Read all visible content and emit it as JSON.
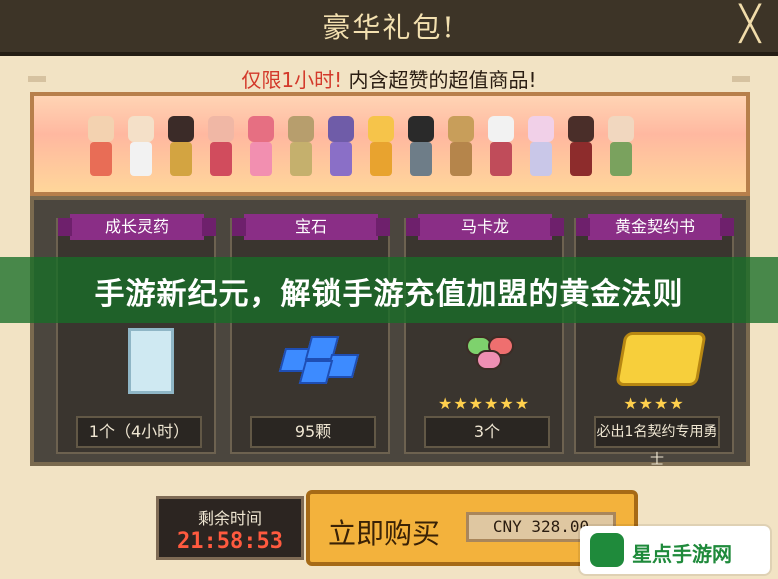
{
  "window": {
    "title": "豪华礼包!",
    "close_label": "╳"
  },
  "subtitle": {
    "red": "仅限1小时!",
    "black": "内含超赞的超值商品!"
  },
  "items": [
    {
      "tag": "成长灵药",
      "quantity": "1个（4小时）",
      "stars": ""
    },
    {
      "tag": "宝石",
      "quantity": "95颗",
      "stars": ""
    },
    {
      "tag": "马卡龙",
      "quantity": "3个",
      "stars": "★★★★★★"
    },
    {
      "tag": "黄金契约书",
      "quantity": "必出1名契约专用勇士",
      "stars": "★★★★"
    }
  ],
  "overlay_headline": "手游新纪元，解锁手游充值加盟的黄金法则",
  "timer": {
    "caption": "剩余时间",
    "time": "21:58:53"
  },
  "purchase": {
    "button_label": "立即购买",
    "price": "CNY 328.00"
  },
  "watermark": {
    "text": "星点手游网"
  },
  "colors": {
    "title_bar": "#3d3427",
    "panel": "#4b463e",
    "tag": "#8a2e86",
    "headline_overlay": "#186e28",
    "buy_button": "#f3b23c",
    "timer_text": "#ff5a3f"
  }
}
